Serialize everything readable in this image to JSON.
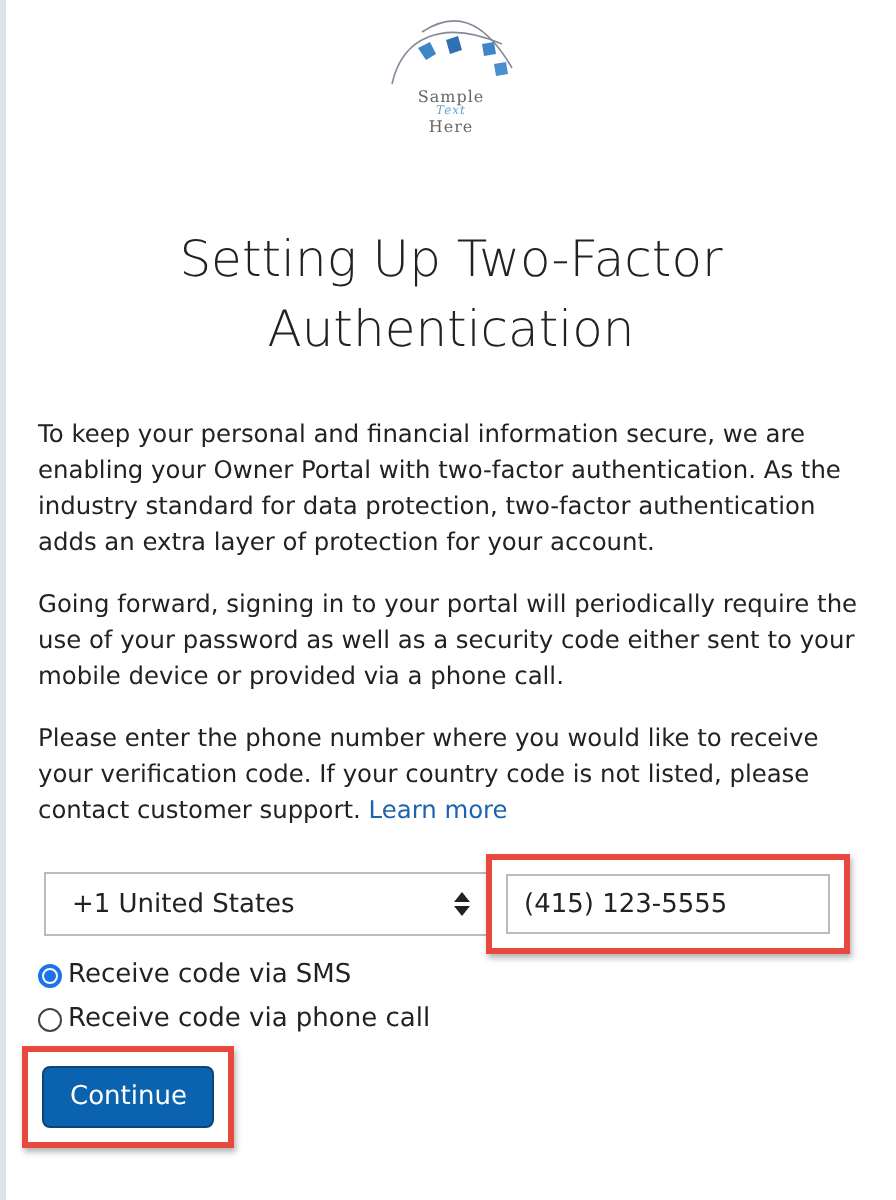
{
  "logo": {
    "lines": [
      "Sample",
      "Text",
      "Here"
    ]
  },
  "title": "Setting Up Two-Factor Authentication",
  "paragraphs": [
    "To keep your personal and financial information secure, we are enabling your Owner Portal with two-factor authentication. As the industry standard for data protection, two-factor authentication adds an extra layer of protection for your account.",
    "Going forward, signing in to your portal will periodically require the use of your password as well as a security code either sent to your mobile device or provided via a phone call."
  ],
  "prompt": {
    "text": "Please enter the phone number where you would like to receive your verification code. If your country code is not listed, please contact customer support.",
    "link": "Learn more"
  },
  "country_select": {
    "value": "+1 United States"
  },
  "phone_field": {
    "value": "(415) 123-5555",
    "highlighted": true
  },
  "options": [
    {
      "label": "Receive code via SMS",
      "selected": true
    },
    {
      "label": "Receive code via phone call",
      "selected": false
    }
  ],
  "continue_button": {
    "label": "Continue",
    "highlighted": true
  }
}
